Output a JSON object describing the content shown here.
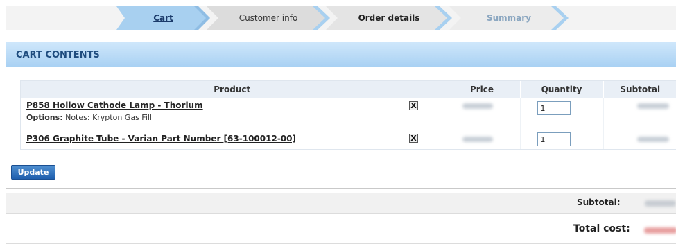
{
  "steps": {
    "cart": "Cart",
    "customer_info": "Customer info",
    "order_details": "Order details",
    "summary": "Summary"
  },
  "panel": {
    "title": "CART CONTENTS"
  },
  "table": {
    "headers": {
      "product": "Product",
      "price": "Price",
      "quantity": "Quantity",
      "subtotal": "Subtotal"
    },
    "rows": [
      {
        "product": "P858 Hollow Cathode Lamp - Thorium",
        "options_label": "Options:",
        "options_value": "Notes: Krypton Gas Fill",
        "remove": "X",
        "quantity": "1"
      },
      {
        "product": "P306 Graphite Tube - Varian Part Number [63-100012-00]",
        "remove": "X",
        "quantity": "1"
      }
    ]
  },
  "buttons": {
    "update": "Update"
  },
  "totals": {
    "subtotal_label": "Subtotal:",
    "total_label": "Total cost:"
  },
  "colors": {
    "header_blue": "#a9d1f3",
    "title_text": "#1e4c7e",
    "button_blue": "#1f5fae",
    "total_blur": "#e8a0a0"
  }
}
